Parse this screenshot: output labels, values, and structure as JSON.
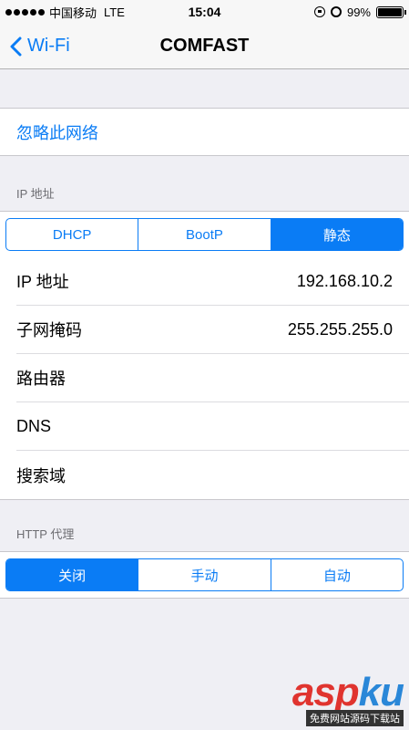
{
  "status_bar": {
    "carrier": "中国移动",
    "network": "LTE",
    "time": "15:04",
    "battery": "99%",
    "battery_level": 0.99
  },
  "nav": {
    "back_label": "Wi-Fi",
    "title": "COMFAST"
  },
  "forget_network": "忽略此网络",
  "ip_section": {
    "header": "IP 地址",
    "segments": [
      "DHCP",
      "BootP",
      "静态"
    ],
    "selected": "静态",
    "rows": [
      {
        "label": "IP 地址",
        "value": "192.168.10.2"
      },
      {
        "label": "子网掩码",
        "value": "255.255.255.0"
      },
      {
        "label": "路由器",
        "value": ""
      },
      {
        "label": "DNS",
        "value": ""
      },
      {
        "label": "搜索域",
        "value": ""
      }
    ]
  },
  "proxy_section": {
    "header": "HTTP 代理",
    "segments": [
      "关闭",
      "手动",
      "自动"
    ],
    "selected": "关闭"
  },
  "watermark": {
    "main": "aspku",
    "sub": "免费网站源码下载站"
  },
  "colors": {
    "accent": "#0a7cf5",
    "background": "#efeff4"
  }
}
